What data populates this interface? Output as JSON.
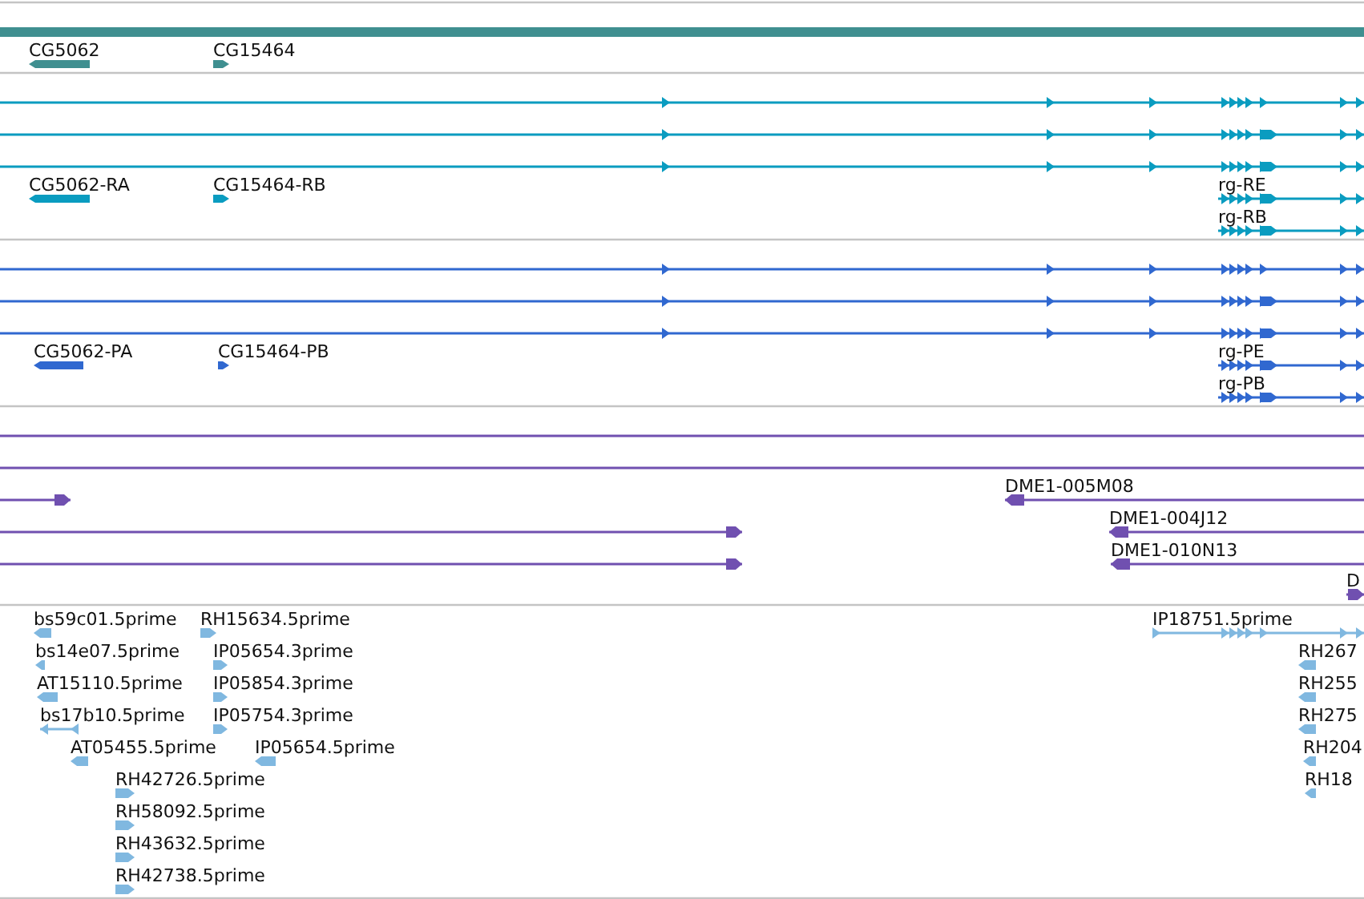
{
  "tracks": [
    {
      "kind": "gene",
      "color": "#3f8f90",
      "features": [
        {
          "kind": "span"
        },
        {
          "kind": "directed",
          "label": "CG5062",
          "reverse": true
        },
        {
          "kind": "directed",
          "label": "CG15464",
          "reverse": false
        }
      ]
    },
    {
      "kind": "transcript",
      "color": "#0a9cc0",
      "features": [
        {
          "kind": "directed",
          "reverse": false
        },
        {
          "kind": "directed",
          "reverse": false
        },
        {
          "kind": "directed",
          "reverse": false
        },
        {
          "kind": "directed",
          "label": "CG5062-RA",
          "reverse": true
        },
        {
          "kind": "directed",
          "label": "CG15464-RB",
          "reverse": false
        },
        {
          "kind": "directed",
          "label": "rg-RE",
          "reverse": false
        },
        {
          "kind": "directed",
          "label": "rg-RB",
          "reverse": false
        }
      ]
    },
    {
      "kind": "transcript",
      "color": "#3068d0",
      "features": [
        {
          "kind": "directed",
          "reverse": false
        },
        {
          "kind": "directed",
          "reverse": false
        },
        {
          "kind": "directed",
          "reverse": false
        },
        {
          "kind": "directed",
          "label": "CG5062-PA",
          "reverse": true
        },
        {
          "kind": "directed",
          "label": "CG15464-PB",
          "reverse": false
        },
        {
          "kind": "directed",
          "label": "rg-PE",
          "reverse": false
        },
        {
          "kind": "directed",
          "label": "rg-PB",
          "reverse": false
        }
      ]
    },
    {
      "kind": "clone",
      "color": "#7050b0",
      "features": [
        {
          "kind": "span"
        },
        {
          "kind": "span"
        },
        {
          "kind": "directed",
          "reverse": false
        },
        {
          "kind": "directed",
          "label": "DME1-005M08",
          "reverse": true
        },
        {
          "kind": "directed",
          "reverse": false
        },
        {
          "kind": "directed",
          "label": "DME1-004J12",
          "reverse": true
        },
        {
          "kind": "directed",
          "reverse": false
        },
        {
          "kind": "directed",
          "label": "DME1-010N13",
          "reverse": true
        },
        {
          "kind": "directed",
          "label": "D",
          "reverse": false
        }
      ]
    },
    {
      "kind": "est",
      "color": "#80b8e0",
      "features": [
        {
          "kind": "directed",
          "label": "bs59c01.5prime",
          "reverse": true
        },
        {
          "kind": "directed",
          "label": "RH15634.5prime",
          "reverse": false
        },
        {
          "kind": "directed",
          "label": "IP18751.5prime",
          "reverse": false
        },
        {
          "kind": "directed",
          "label": "bs14e07.5prime",
          "reverse": true
        },
        {
          "kind": "directed",
          "label": "IP05654.3prime",
          "reverse": false
        },
        {
          "kind": "directed",
          "label": "RH267",
          "reverse": true
        },
        {
          "kind": "directed",
          "label": "AT15110.5prime",
          "reverse": true
        },
        {
          "kind": "directed",
          "label": "IP05854.3prime",
          "reverse": false
        },
        {
          "kind": "directed",
          "label": "RH255",
          "reverse": true
        },
        {
          "kind": "directed",
          "label": "bs17b10.5prime",
          "reverse": true
        },
        {
          "kind": "directed",
          "label": "IP05754.3prime",
          "reverse": false
        },
        {
          "kind": "directed",
          "label": "RH275",
          "reverse": true
        },
        {
          "kind": "directed",
          "label": "AT05455.5prime",
          "reverse": true
        },
        {
          "kind": "directed",
          "label": "IP05654.5prime",
          "reverse": true
        },
        {
          "kind": "directed",
          "label": "RH204",
          "reverse": true
        },
        {
          "kind": "directed",
          "label": "RH42726.5prime",
          "reverse": false
        },
        {
          "kind": "directed",
          "label": "RH18",
          "reverse": true
        },
        {
          "kind": "directed",
          "label": "RH58092.5prime",
          "reverse": false
        },
        {
          "kind": "directed",
          "label": "RH43632.5prime",
          "reverse": false
        },
        {
          "kind": "directed",
          "label": "RH42738.5prime",
          "reverse": false
        }
      ]
    }
  ]
}
